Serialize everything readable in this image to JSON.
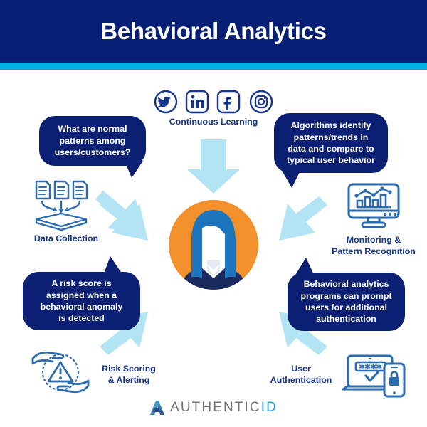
{
  "header": {
    "title": "Behavioral Analytics",
    "bg_color": "#061F74",
    "accent_color": "#00B2E3",
    "text_color": "#FFFFFF"
  },
  "colors": {
    "navy": "#0B2073",
    "label_blue": "#15348C",
    "icon_blue": "#2B6CB0",
    "arrow_blue": "#B3E4F4",
    "avatar_orange": "#F2902B",
    "hair_blue": "#1C75BC",
    "shoulder_navy": "#1B2A5E"
  },
  "center": {
    "name": "user-avatar",
    "description": "person avatar in orange circle"
  },
  "social": {
    "label": "Continuous Learning",
    "icons": [
      {
        "name": "twitter-icon",
        "glyph": "twitter",
        "shape": "circle"
      },
      {
        "name": "linkedin-icon",
        "glyph": "in",
        "shape": "rounded-square"
      },
      {
        "name": "facebook-icon",
        "glyph": "f",
        "shape": "rounded-square"
      },
      {
        "name": "instagram-icon",
        "glyph": "camera",
        "shape": "circle"
      }
    ]
  },
  "bubbles": [
    {
      "id": "normal-patterns",
      "text": "What are normal\npatterns among\nusers/customers?",
      "tail": "bottom-right"
    },
    {
      "id": "algorithms",
      "text": "Algorithms identify\npatterns/trends in\ndata and compare to\ntypical user behavior",
      "tail": "bottom-left"
    },
    {
      "id": "risk-score",
      "text": "A risk score is\nassigned when a\nbehavioral anomaly\nis detected",
      "tail": "top-right"
    },
    {
      "id": "behavioral-analytics",
      "text": "Behavioral analytics\nprograms can prompt\nusers for additional\nauthentication",
      "tail": "top-left"
    }
  ],
  "labels": {
    "data_collection": "Data Collection",
    "monitoring": "Monitoring &\nPattern Recognition",
    "risk_scoring": "Risk Scoring\n& Alerting",
    "user_authentication": "User\nAuthentication"
  },
  "icons": {
    "data_collection": "documents-into-box-icon",
    "monitoring": "monitor-chart-icon",
    "risk_scoring": "hands-warning-triangle-icon",
    "user_authentication": "laptop-phone-lock-icon"
  },
  "arrows": {
    "count": 5,
    "color": "#B3E4F4",
    "directions": [
      "down",
      "down-right",
      "down-left",
      "up-right",
      "up-left"
    ]
  },
  "footer": {
    "brand_part1": "AUTHENTIC",
    "brand_part2": "ID",
    "mark": "authenticid-a-mark"
  }
}
